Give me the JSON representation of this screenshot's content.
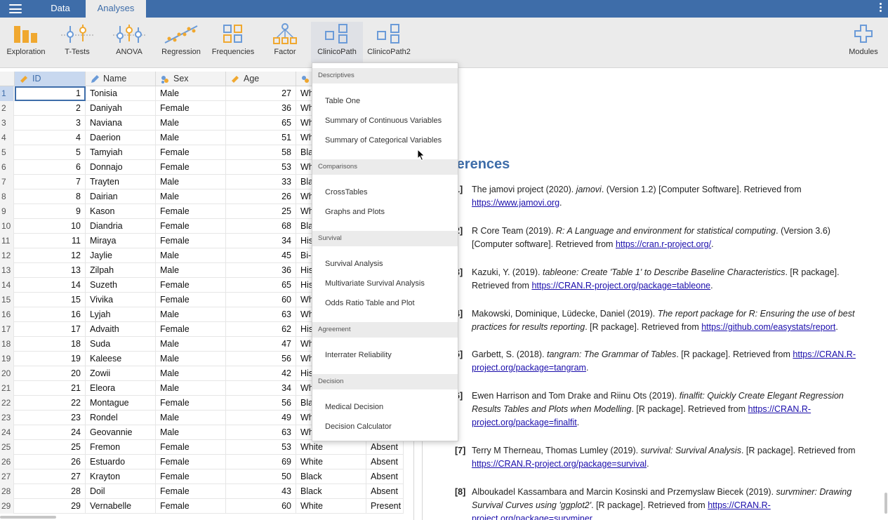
{
  "tabs": {
    "data": "Data",
    "analyses": "Analyses"
  },
  "ribbon": [
    {
      "label": "Exploration",
      "icon": "exploration-icon"
    },
    {
      "label": "T-Tests",
      "icon": "t-tests-icon"
    },
    {
      "label": "ANOVA",
      "icon": "anova-icon"
    },
    {
      "label": "Regression",
      "icon": "regression-icon"
    },
    {
      "label": "Frequencies",
      "icon": "frequencies-icon"
    },
    {
      "label": "Factor",
      "icon": "factor-icon"
    },
    {
      "label": "ClinicoPath",
      "icon": "clinicopath-icon"
    },
    {
      "label": "ClinicoPath2",
      "icon": "clinicopath2-icon"
    },
    {
      "label": "Modules",
      "icon": "modules-plus-icon"
    }
  ],
  "grid": {
    "headers": [
      "ID",
      "Name",
      "Sex",
      "Age"
    ],
    "rows": [
      [
        "1",
        "1",
        "Tonisia",
        "Male",
        "27",
        "Wh",
        ""
      ],
      [
        "2",
        "2",
        "Daniyah",
        "Female",
        "36",
        "Wh",
        ""
      ],
      [
        "3",
        "3",
        "Naviana",
        "Male",
        "65",
        "Wh",
        ""
      ],
      [
        "4",
        "4",
        "Daerion",
        "Male",
        "51",
        "Wh",
        ""
      ],
      [
        "5",
        "5",
        "Tamyiah",
        "Female",
        "58",
        "Bla",
        ""
      ],
      [
        "6",
        "6",
        "Donnajo",
        "Female",
        "53",
        "Wh",
        ""
      ],
      [
        "7",
        "7",
        "Trayten",
        "Male",
        "33",
        "Bla",
        ""
      ],
      [
        "8",
        "8",
        "Dairian",
        "Male",
        "26",
        "Wh",
        ""
      ],
      [
        "9",
        "9",
        "Kason",
        "Female",
        "25",
        "Wh",
        ""
      ],
      [
        "10",
        "10",
        "Diandria",
        "Female",
        "68",
        "Bla",
        ""
      ],
      [
        "11",
        "11",
        "Miraya",
        "Female",
        "34",
        "His",
        ""
      ],
      [
        "12",
        "12",
        "Jaylie",
        "Male",
        "45",
        "Bi-",
        ""
      ],
      [
        "13",
        "13",
        "Zilpah",
        "Male",
        "36",
        "His",
        ""
      ],
      [
        "14",
        "14",
        "Suzeth",
        "Female",
        "65",
        "His",
        ""
      ],
      [
        "15",
        "15",
        "Vivika",
        "Female",
        "60",
        "Wh",
        ""
      ],
      [
        "16",
        "16",
        "Lyjah",
        "Male",
        "63",
        "Wh",
        ""
      ],
      [
        "17",
        "17",
        "Advaith",
        "Female",
        "62",
        "His",
        ""
      ],
      [
        "18",
        "18",
        "Suda",
        "Male",
        "47",
        "Wh",
        ""
      ],
      [
        "19",
        "19",
        "Kaleese",
        "Male",
        "56",
        "Wh",
        ""
      ],
      [
        "20",
        "20",
        "Zowii",
        "Male",
        "42",
        "His",
        ""
      ],
      [
        "21",
        "21",
        "Eleora",
        "Male",
        "34",
        "Wh",
        ""
      ],
      [
        "22",
        "22",
        "Montague",
        "Female",
        "56",
        "Bla",
        ""
      ],
      [
        "23",
        "23",
        "Rondel",
        "Male",
        "49",
        "Wh",
        ""
      ],
      [
        "24",
        "24",
        "Geovannie",
        "Male",
        "63",
        "Wh",
        ""
      ],
      [
        "25",
        "25",
        "Fremon",
        "Female",
        "53",
        "White",
        "Absent"
      ],
      [
        "26",
        "26",
        "Estuardo",
        "Female",
        "69",
        "White",
        "Absent"
      ],
      [
        "27",
        "27",
        "Krayton",
        "Female",
        "50",
        "Black",
        "Absent"
      ],
      [
        "28",
        "28",
        "Doil",
        "Female",
        "43",
        "Black",
        "Absent"
      ],
      [
        "29",
        "29",
        "Vernabelle",
        "Female",
        "60",
        "White",
        "Present"
      ]
    ]
  },
  "menu": {
    "sections": [
      {
        "title": "Descriptives",
        "items": [
          "Table One",
          "Summary of Continuous Variables",
          "Summary of Categorical Variables"
        ]
      },
      {
        "title": "Comparisons",
        "items": [
          "CrossTables",
          "Graphs and Plots"
        ]
      },
      {
        "title": "Survival",
        "items": [
          "Survival Analysis",
          "Multivariate Survival Analysis",
          "Odds Ratio Table and Plot"
        ]
      },
      {
        "title": "Agreement",
        "items": [
          "Interrater Reliability"
        ]
      },
      {
        "title": "Decision",
        "items": [
          "Medical Decision",
          "Decision Calculator"
        ]
      }
    ]
  },
  "results": {
    "title": "ferences",
    "refs": [
      {
        "num": "1]",
        "parts": [
          [
            "t",
            "The jamovi project (2020). "
          ],
          [
            "i",
            "jamovi"
          ],
          [
            "t",
            ". (Version 1.2) [Computer Software]. Retrieved from "
          ],
          [
            "a",
            "https://www.jamovi.org"
          ],
          [
            "t",
            "."
          ]
        ]
      },
      {
        "num": "2]",
        "parts": [
          [
            "t",
            "R Core Team (2019). "
          ],
          [
            "i",
            "R: A Language and environment for statistical computing"
          ],
          [
            "t",
            ". (Version 3.6) [Computer software]. Retrieved from "
          ],
          [
            "a",
            "https://cran.r-project.org/"
          ],
          [
            "t",
            "."
          ]
        ]
      },
      {
        "num": "3]",
        "parts": [
          [
            "t",
            "Kazuki, Y. (2019). "
          ],
          [
            "i",
            "tableone: Create 'Table 1' to Describe Baseline Characteristics"
          ],
          [
            "t",
            ". [R package]. Retrieved from "
          ],
          [
            "a",
            "https://CRAN.R-project.org/package=tableone"
          ],
          [
            "t",
            "."
          ]
        ]
      },
      {
        "num": "4]",
        "parts": [
          [
            "t",
            "Makowski, Dominique, Lüdecke, Daniel (2019). "
          ],
          [
            "i",
            "The report package for R: Ensuring the use of best practices for results reporting"
          ],
          [
            "t",
            ". [R package]. Retrieved from "
          ],
          [
            "a",
            "https://github.com/easystats/report"
          ],
          [
            "t",
            "."
          ]
        ]
      },
      {
        "num": "5]",
        "parts": [
          [
            "t",
            "Garbett, S. (2018). "
          ],
          [
            "i",
            "tangram: The Grammar of Tables"
          ],
          [
            "t",
            ". [R package]. Retrieved from "
          ],
          [
            "a",
            "https://CRAN.R-project.org/package=tangram"
          ],
          [
            "t",
            "."
          ]
        ]
      },
      {
        "num": "6]",
        "parts": [
          [
            "t",
            "Ewen Harrison and Tom Drake and Riinu Ots (2019). "
          ],
          [
            "i",
            "finalfit: Quickly Create Elegant Regression Results Tables and Plots when Modelling"
          ],
          [
            "t",
            ". [R package]. Retrieved from "
          ],
          [
            "a",
            "https://CRAN.R-project.org/package=finalfit"
          ],
          [
            "t",
            "."
          ]
        ]
      },
      {
        "num": "[7]",
        "parts": [
          [
            "t",
            "Terry M Therneau, Thomas Lumley (2019). "
          ],
          [
            "i",
            "survival: Survival Analysis"
          ],
          [
            "t",
            ". [R package]. Retrieved from "
          ],
          [
            "a",
            "https://CRAN.R-project.org/package=survival"
          ],
          [
            "t",
            "."
          ]
        ]
      },
      {
        "num": "[8]",
        "parts": [
          [
            "t",
            "Alboukadel Kassambara and Marcin Kosinski and Przemyslaw Biecek (2019). "
          ],
          [
            "i",
            "survminer: Drawing Survival Curves using 'ggplot2'"
          ],
          [
            "t",
            ". [R package]. Retrieved from "
          ],
          [
            "a",
            "https://CRAN.R-project.org/package=survminer"
          ],
          [
            "t",
            "."
          ]
        ]
      }
    ]
  },
  "colors": {
    "brand": "#3e6da9",
    "ribbon_bg": "#ebebeb",
    "icon_orange": "#f0a830",
    "icon_blue": "#6b9bd8",
    "link": "#1a0dab"
  }
}
